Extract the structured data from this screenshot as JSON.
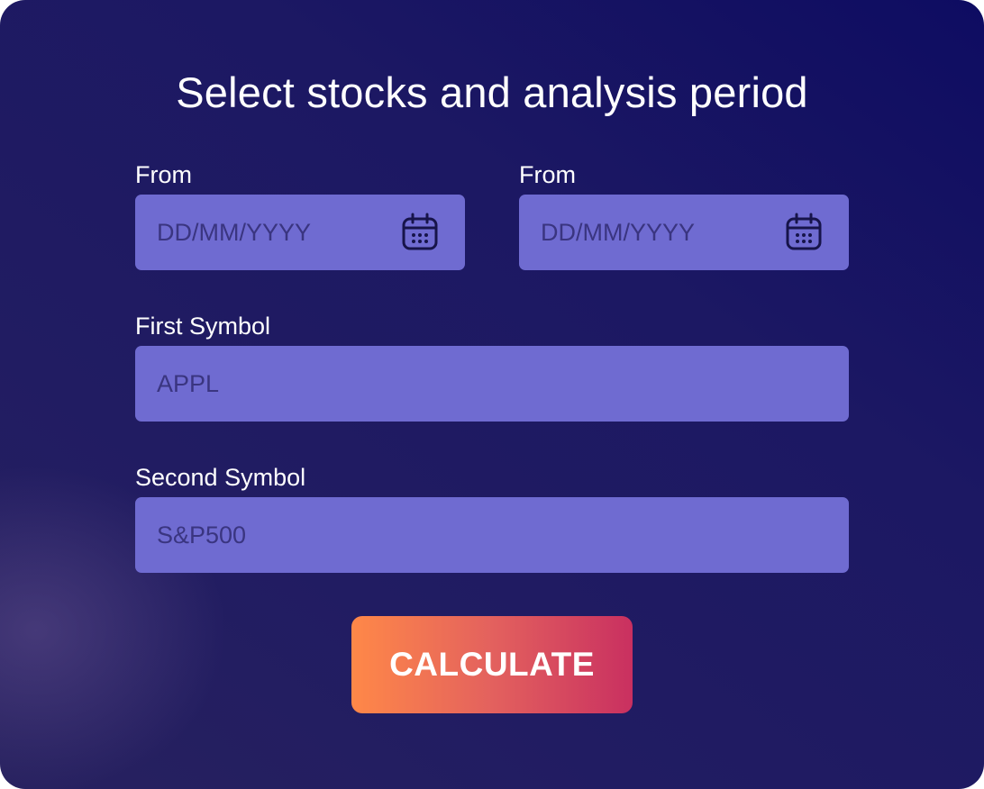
{
  "form": {
    "title": "Select stocks and analysis period",
    "from_date": {
      "label": "From",
      "placeholder": "DD/MM/YYYY",
      "icon": "calendar-icon"
    },
    "to_date": {
      "label": "From",
      "placeholder": "DD/MM/YYYY",
      "icon": "calendar-icon"
    },
    "first_symbol": {
      "label": "First Symbol",
      "value": "APPL"
    },
    "second_symbol": {
      "label": "Second Symbol",
      "value": "S&P500"
    },
    "submit_label": "CALCULATE"
  },
  "colors": {
    "background_dark": "#0e0c62",
    "background_mid": "#211c62",
    "field_fill": "#6f6bd1",
    "field_text": "#3a3580",
    "button_start": "#ff8848",
    "button_end": "#c93060"
  }
}
